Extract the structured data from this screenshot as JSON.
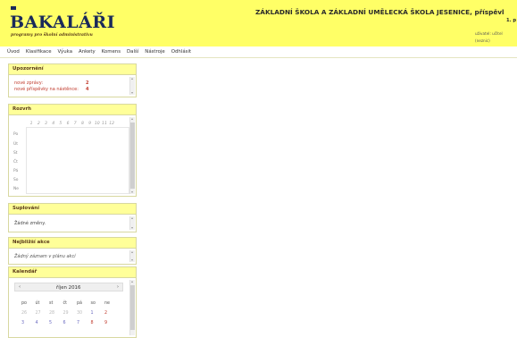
{
  "header": {
    "logo": "BAKALÁŘI",
    "logo_subtitle": "programy pro školní administrativu",
    "school_name": "ZÁKLADNÍ ŠKOLA A ZÁKLADNÍ UMĚLECKÁ ŠKOLA JESENICE, příspěvl",
    "school_sub": "1. p",
    "user_label": "uživatel: učitel",
    "user_value": "(neznic)",
    "accent_color": "#ffff66"
  },
  "menu": {
    "items": [
      "Úvod",
      "Klasifikace",
      "Výuka",
      "Ankety",
      "Komens",
      "Další",
      "Nástroje",
      "Odhlásit"
    ]
  },
  "panels": {
    "upozorneni": {
      "title": "Upozornění",
      "rows": [
        {
          "label": "nové zprávy:",
          "value": "2"
        },
        {
          "label": "nové příspěvky na nástěnce:",
          "value": "4"
        }
      ]
    },
    "rozvrh": {
      "title": "Rozvrh",
      "periods": [
        "1",
        "2",
        "3",
        "4",
        "5",
        "6",
        "7",
        "8",
        "9",
        "10",
        "11",
        "12"
      ],
      "days": [
        "Po",
        "Út",
        "St",
        "Čt",
        "Pá",
        "So",
        "Ne"
      ]
    },
    "suplovani": {
      "title": "Suplování",
      "text": "Žádné změny."
    },
    "akce": {
      "title": "Nejbližší akce",
      "text": "Žádný záznam v plánu akcí"
    },
    "kalendar": {
      "title": "Kalendář",
      "month": "říjen 2016",
      "prev": "‹",
      "next": "›",
      "weekdays": [
        "po",
        "út",
        "st",
        "čt",
        "pá",
        "so",
        "ne"
      ],
      "weeks": [
        [
          "26",
          "27",
          "28",
          "29",
          "30",
          "1",
          "2"
        ],
        [
          "3",
          "4",
          "5",
          "6",
          "7",
          "8",
          "9"
        ]
      ]
    }
  }
}
